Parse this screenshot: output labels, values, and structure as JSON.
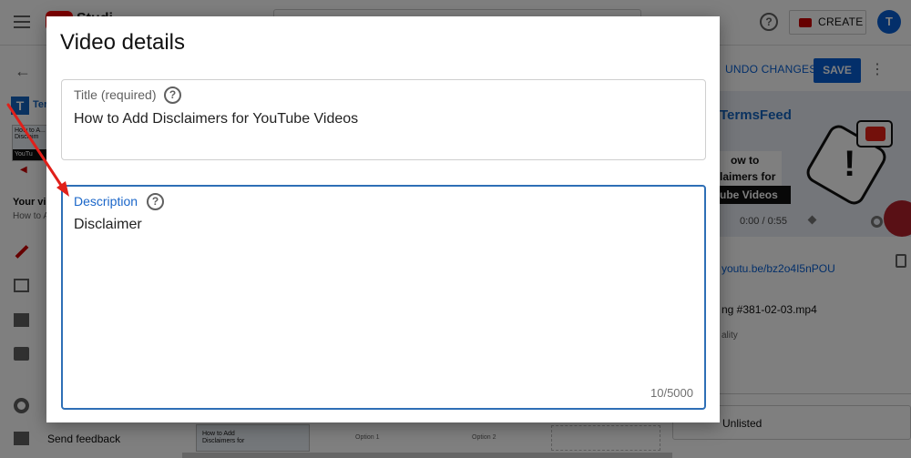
{
  "topbar": {
    "logo_text": "Studi",
    "create_label": "CREATE",
    "avatar_letter": "T",
    "help_glyph": "?",
    "icons": [
      "hamburger-icon",
      "youtube-logo",
      "help-icon",
      "camera-icon"
    ]
  },
  "sidebar": {
    "brand": "Term",
    "channel_letter": "T",
    "thumb_text": "How to A... Disclaim",
    "thumb_bar": "YouTu",
    "heading": "Your vid",
    "subheading": "How to A",
    "send_feedback": "Send feedback",
    "icons": [
      "back-arrow-icon",
      "pencil-icon",
      "stats-icon",
      "film-icon",
      "comment-icon",
      "gear-icon",
      "feedback-icon"
    ]
  },
  "actions": {
    "undo_changes": "UNDO CHANGES",
    "save": "SAVE",
    "more_glyph": "⋮"
  },
  "preview": {
    "brand": "TermsFeed",
    "line1": "ow to Add",
    "line2": "laimers for",
    "line3": "ube Videos",
    "time": "0:00 / 0:55",
    "video_link": "youtu.be/bz2o4I5nPOU",
    "filename": "ng #381-02-03.mp4",
    "quality": "ality",
    "visibility": "Unlisted"
  },
  "bottom": {
    "thumb_text": "How to Add Disclaimers for",
    "option1": "Option 1",
    "option2": "Option 2"
  },
  "dialog": {
    "title": "Video details",
    "title_field": {
      "label": "Title (required)",
      "value": "How to Add Disclaimers for YouTube Videos",
      "help_glyph": "?"
    },
    "description_field": {
      "label": "Description",
      "value": "Disclaimer",
      "counter": "10/5000",
      "help_glyph": "?"
    }
  },
  "colors": {
    "primary_blue": "#065fd4",
    "focus_blue": "#2e6fb6",
    "annotation_red": "#e0201a",
    "brand_red": "#ff0000"
  }
}
